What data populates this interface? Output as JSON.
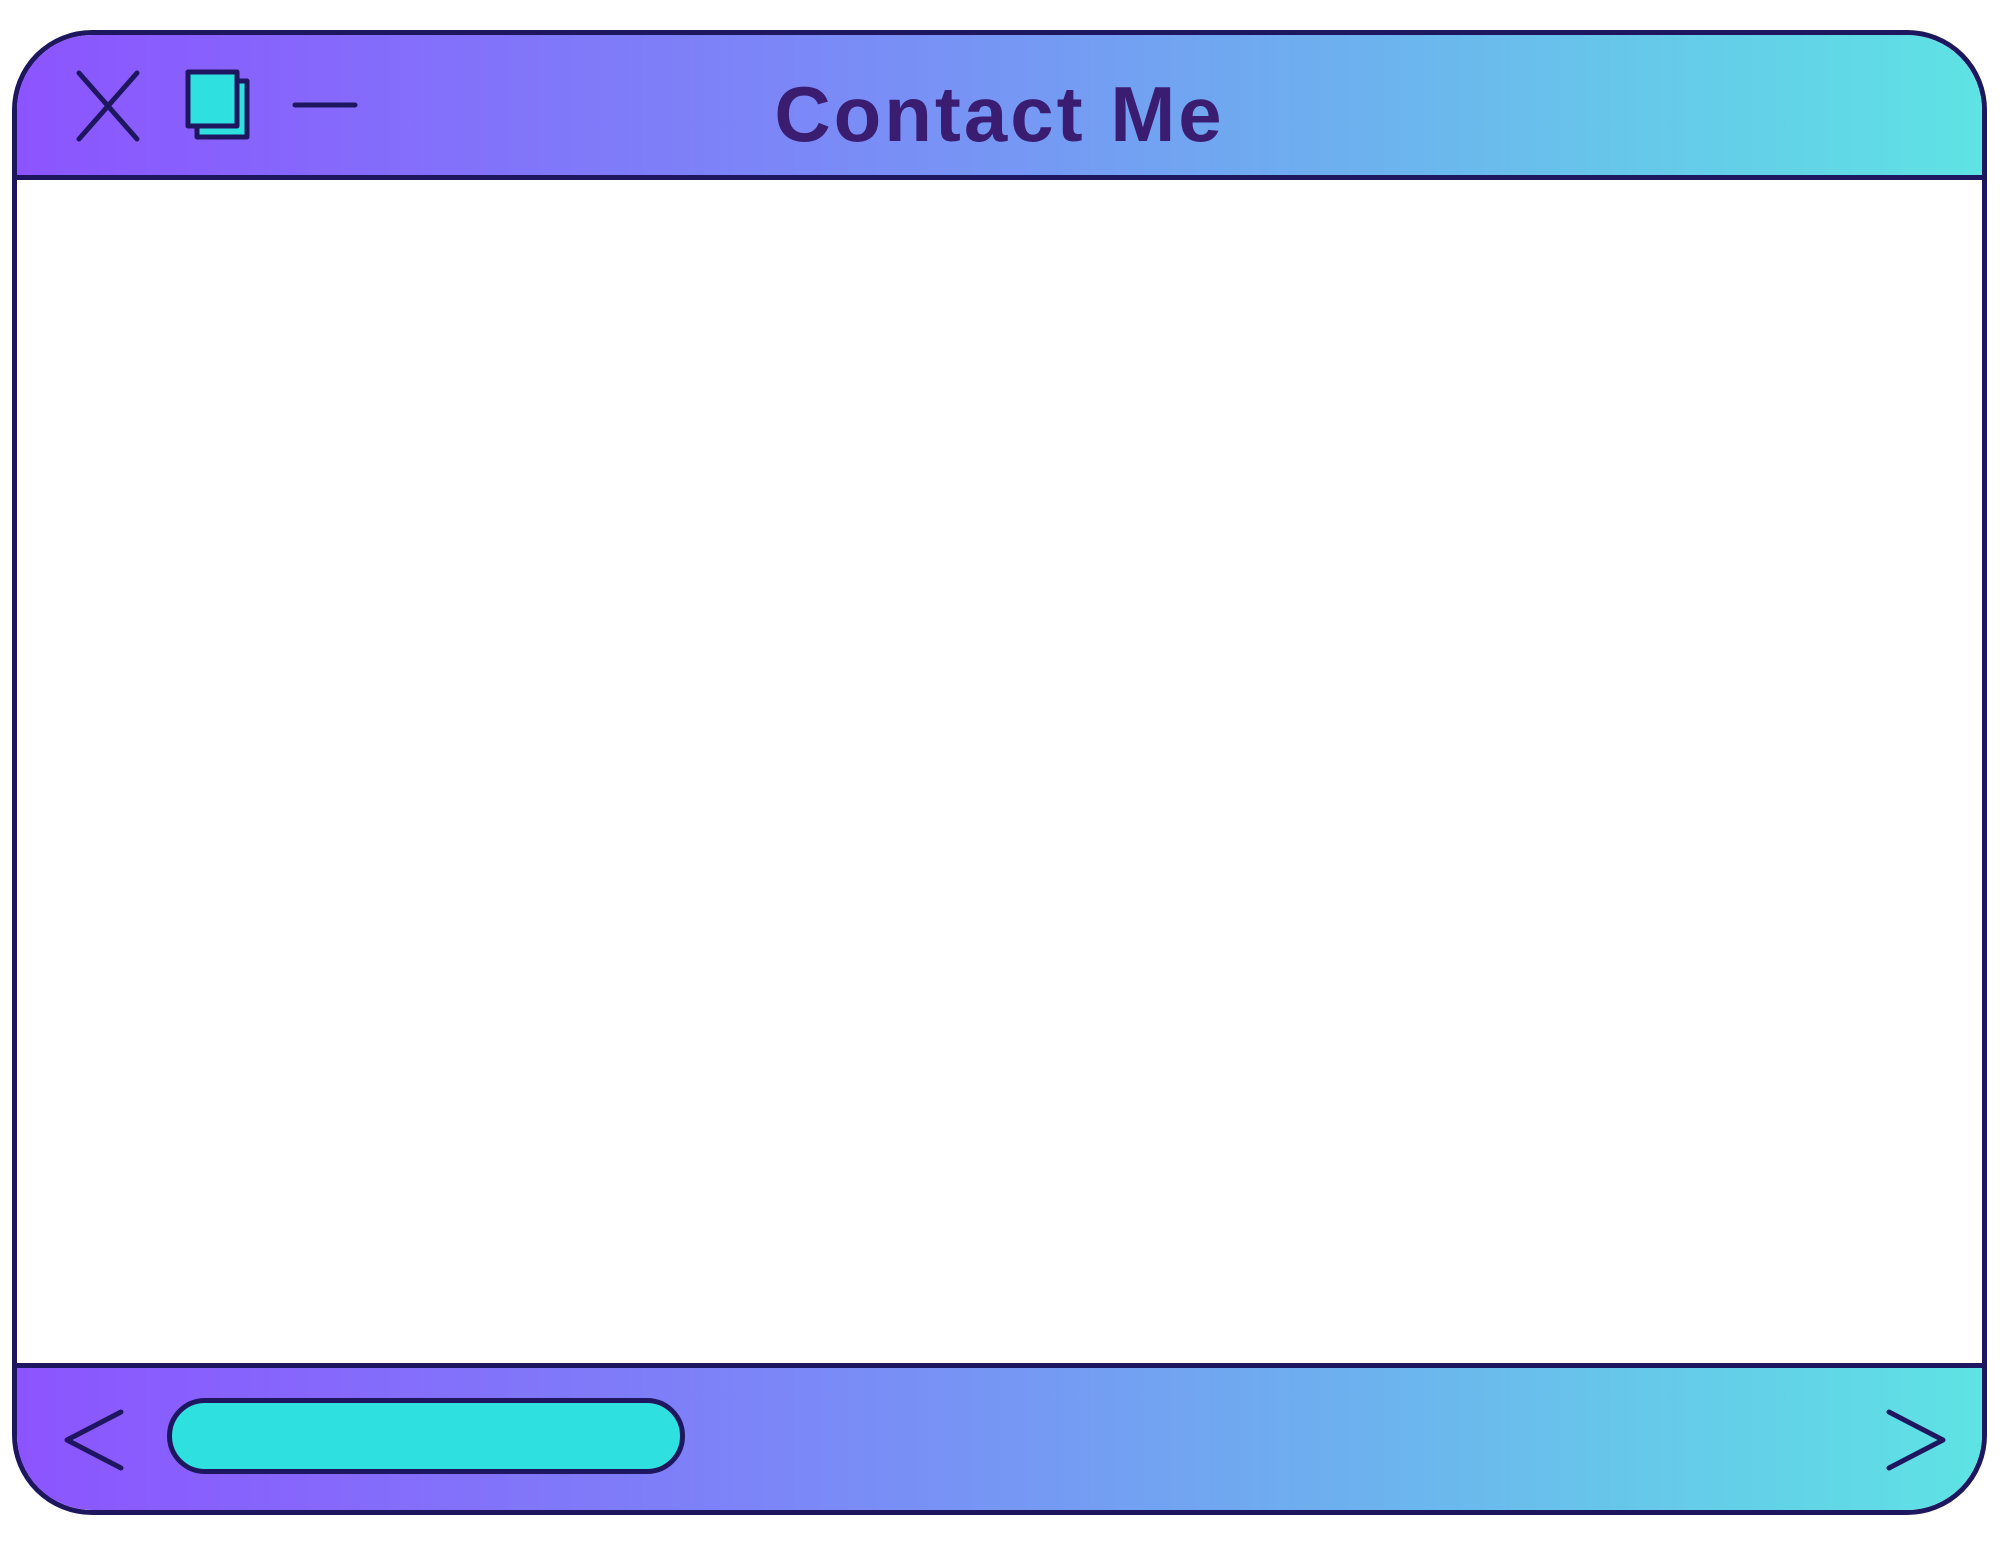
{
  "window": {
    "title": "Contact Me",
    "controls": {
      "close_icon": "close-icon",
      "maximize_icon": "restore-windows-icon",
      "minimize_icon": "minimize-icon"
    },
    "content": "",
    "scrollbar": {
      "left_arrow_icon": "chevron-left-icon",
      "right_arrow_icon": "chevron-right-icon",
      "thumb_position": 0.0
    }
  },
  "colors": {
    "outline": "#1e1760",
    "title_text": "#3a1c71",
    "gradient_start": "#8c54ff",
    "gradient_end": "#5ee3e4",
    "accent": "#2fe0e0"
  }
}
